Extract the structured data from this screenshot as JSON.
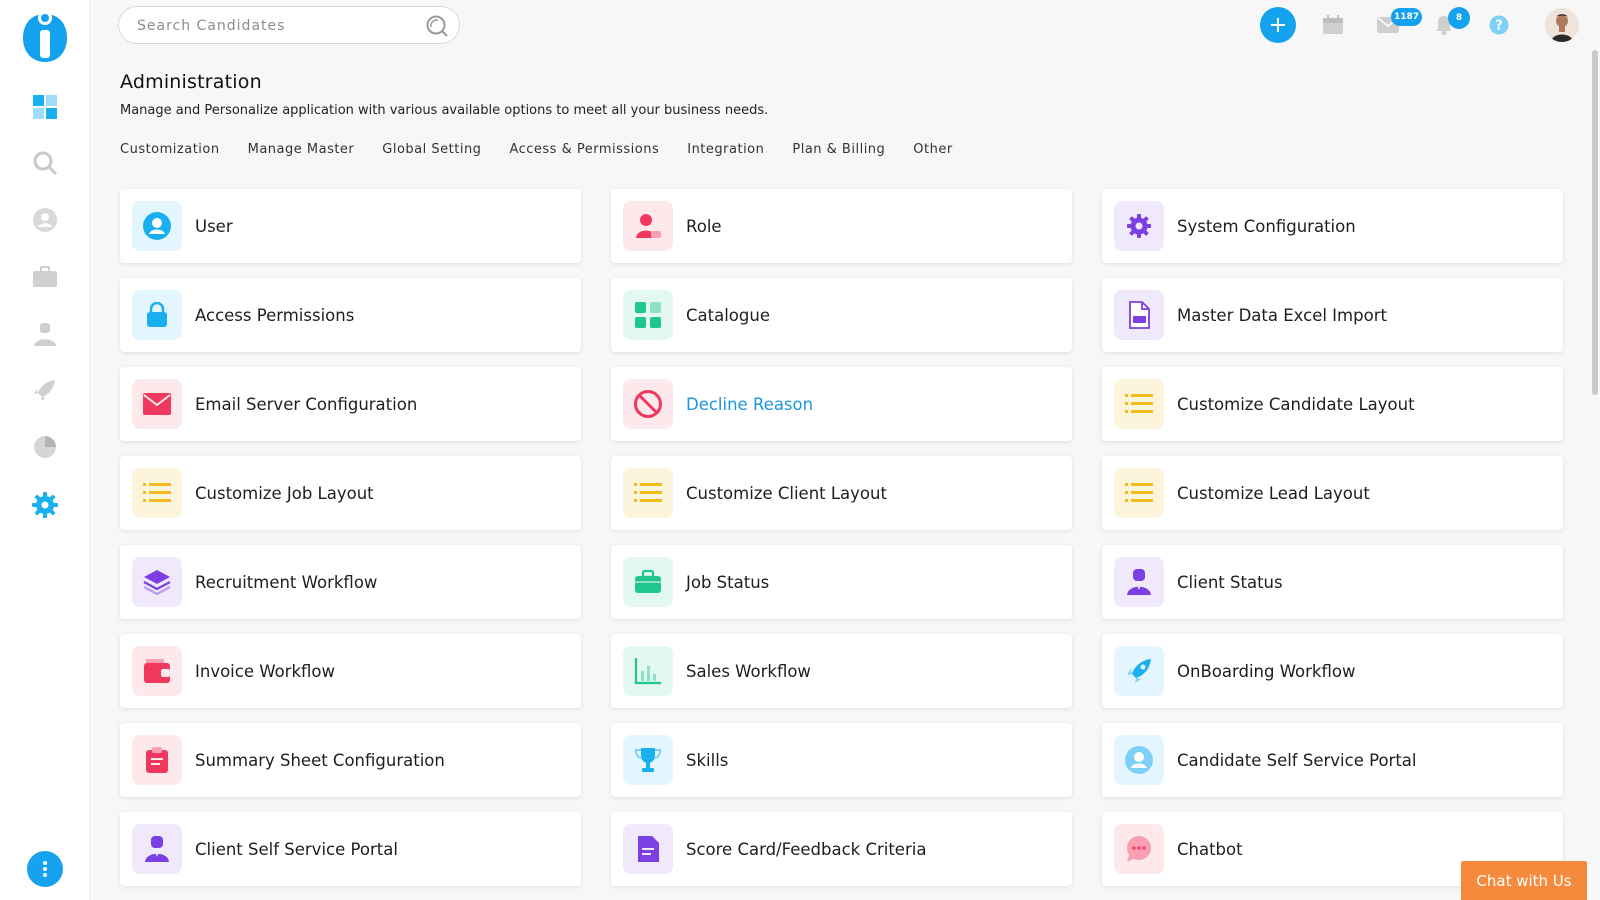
{
  "search": {
    "placeholder": "Search Candidates"
  },
  "header": {
    "title": "Administration",
    "subtitle": "Manage and Personalize application with various available options to meet all your business needs."
  },
  "tabs": [
    "Customization",
    "Manage Master",
    "Global Setting",
    "Access & Permissions",
    "Integration",
    "Plan & Billing",
    "Other"
  ],
  "topbar": {
    "mail_badge": "1187",
    "notification_badge": "8"
  },
  "sidebar": {
    "items": [
      "dashboard-icon",
      "search-icon",
      "candidate-icon",
      "jobs-icon",
      "client-icon",
      "rocket-icon",
      "reports-icon",
      "settings-icon"
    ]
  },
  "cards": [
    {
      "label": "User",
      "icon": "user-icon",
      "tile": "#e3f5fd",
      "color": "#1ab0f0"
    },
    {
      "label": "Role",
      "icon": "role-icon",
      "tile": "#fde8ec",
      "color": "#f0385e"
    },
    {
      "label": "System Configuration",
      "icon": "gear-icon",
      "tile": "#efe9fb",
      "color": "#7b3fe4"
    },
    {
      "label": "Access Permissions",
      "icon": "lock-icon",
      "tile": "#e3f5fd",
      "color": "#1ab0f0"
    },
    {
      "label": "Catalogue",
      "icon": "grid-icon",
      "tile": "#e2f8f0",
      "color": "#20c590"
    },
    {
      "label": "Master Data Excel Import",
      "icon": "xls-file-icon",
      "tile": "#efe9fb",
      "color": "#7b3fe4"
    },
    {
      "label": "Email Server Configuration",
      "icon": "envelope-icon",
      "tile": "#fde8ec",
      "color": "#f0385e"
    },
    {
      "label": "Decline Reason",
      "icon": "ban-icon",
      "tile": "#fde8ec",
      "color": "#f0385e",
      "link": true
    },
    {
      "label": "Customize Candidate Layout",
      "icon": "list-icon",
      "tile": "#fdf4dc",
      "color": "#f4b91e"
    },
    {
      "label": "Customize Job Layout",
      "icon": "list-icon",
      "tile": "#fdf4dc",
      "color": "#f4b91e"
    },
    {
      "label": "Customize Client Layout",
      "icon": "list-icon",
      "tile": "#fdf4dc",
      "color": "#f4b91e"
    },
    {
      "label": "Customize Lead Layout",
      "icon": "list-icon",
      "tile": "#fdf4dc",
      "color": "#f4b91e"
    },
    {
      "label": "Recruitment Workflow",
      "icon": "layers-icon",
      "tile": "#efe9fb",
      "color": "#7b3fe4"
    },
    {
      "label": "Job Status",
      "icon": "briefcase-icon",
      "tile": "#e2f8f0",
      "color": "#20c590"
    },
    {
      "label": "Client Status",
      "icon": "client-icon",
      "tile": "#efe9fb",
      "color": "#7b3fe4"
    },
    {
      "label": "Invoice Workflow",
      "icon": "wallet-icon",
      "tile": "#fde8ec",
      "color": "#f0385e"
    },
    {
      "label": "Sales Workflow",
      "icon": "bar-chart-icon",
      "tile": "#e2f8f0",
      "color": "#20c590"
    },
    {
      "label": "OnBoarding Workflow",
      "icon": "rocket-icon",
      "tile": "#e3f5fd",
      "color": "#1ab0f0"
    },
    {
      "label": "Summary Sheet Configuration",
      "icon": "clipboard-icon",
      "tile": "#fde8ec",
      "color": "#f0385e"
    },
    {
      "label": "Skills",
      "icon": "trophy-icon",
      "tile": "#e3f5fd",
      "color": "#1ab0f0"
    },
    {
      "label": "Candidate Self Service Portal",
      "icon": "user-icon",
      "tile": "#e3f5fd",
      "color": "#1ab0f0"
    },
    {
      "label": "Client Self Service Portal",
      "icon": "client-icon",
      "tile": "#efe9fb",
      "color": "#7b3fe4"
    },
    {
      "label": "Score Card/Feedback Criteria",
      "icon": "document-icon",
      "tile": "#efe9fb",
      "color": "#7b3fe4"
    },
    {
      "label": "Chatbot",
      "icon": "chat-bubble-icon",
      "tile": "#fde8ec",
      "color": "#f0385e"
    }
  ],
  "chat": {
    "label": "Chat with Us"
  }
}
